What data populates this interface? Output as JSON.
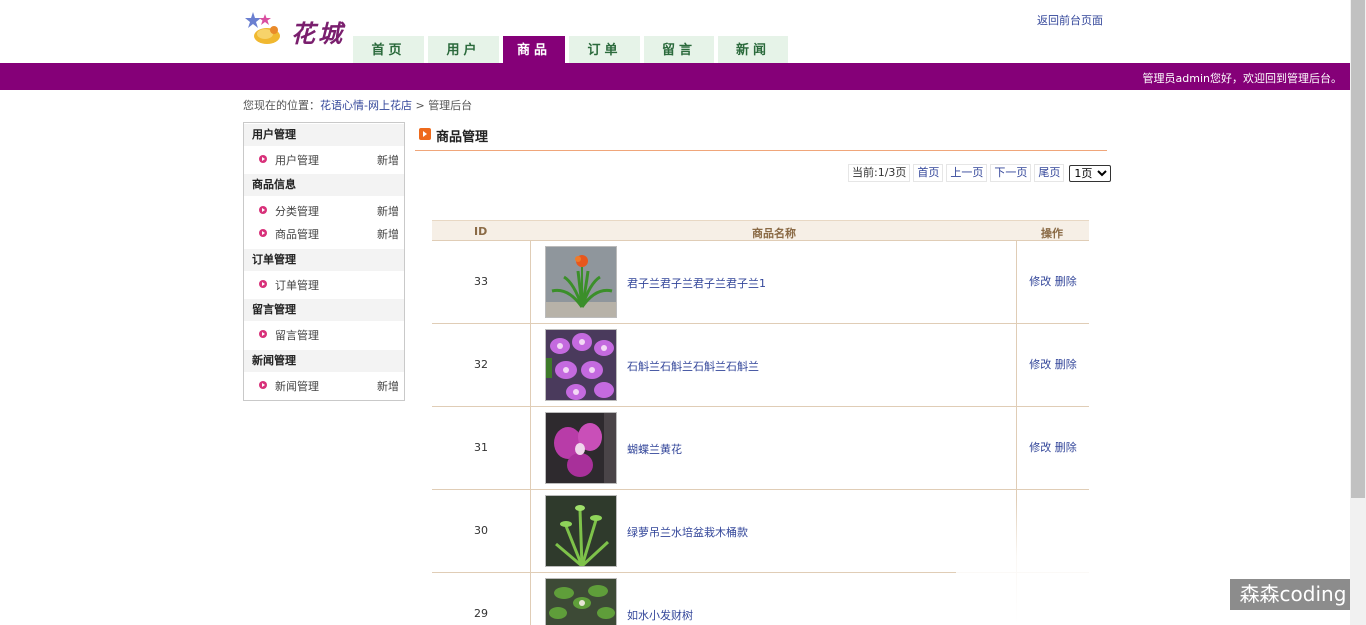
{
  "header": {
    "logo_text": "花城",
    "back_link": "返回前台页面",
    "nav": [
      "首页",
      "用户",
      "商品",
      "订单",
      "留言",
      "新闻"
    ],
    "active_nav": "商品",
    "welcome": "管理员admin您好，欢迎回到管理后台。",
    "accent_color": "#850078"
  },
  "breadcrumb": {
    "prefix": "您现在的位置：",
    "link": "花语心情-网上花店",
    "sep": ">",
    "current": "管理后台"
  },
  "sidebar": {
    "groups": [
      {
        "title": "用户管理",
        "items": [
          {
            "label": "用户管理",
            "add": "新增"
          }
        ]
      },
      {
        "title": "商品信息",
        "items": [
          {
            "label": "分类管理",
            "add": "新增"
          },
          {
            "label": "商品管理",
            "add": "新增"
          }
        ]
      },
      {
        "title": "订单管理",
        "items": [
          {
            "label": "订单管理",
            "add": ""
          }
        ]
      },
      {
        "title": "留言管理",
        "items": [
          {
            "label": "留言管理",
            "add": ""
          }
        ]
      },
      {
        "title": "新闻管理",
        "items": [
          {
            "label": "新闻管理",
            "add": "新增"
          }
        ]
      }
    ]
  },
  "main": {
    "title": "商品管理",
    "pager": {
      "current": "当前:1/3页",
      "first": "首页",
      "prev": "上一页",
      "next": "下一页",
      "last": "尾页",
      "select_value": "1页"
    },
    "table": {
      "headers": {
        "id": "ID",
        "name": "商品名称",
        "op": "操作"
      },
      "rows": [
        {
          "id": "33",
          "name": "君子兰君子兰君子兰君子兰1",
          "edit": "修改",
          "del": "删除"
        },
        {
          "id": "32",
          "name": "石斛兰石斛兰石斛兰石斛兰",
          "edit": "修改",
          "del": "删除"
        },
        {
          "id": "31",
          "name": "蝴蝶兰黄花",
          "edit": "修改",
          "del": "删除"
        },
        {
          "id": "30",
          "name": "绿萝吊兰水培盆栽木桶款",
          "edit": "",
          "del": ""
        },
        {
          "id": "29",
          "name": "如水小发财树",
          "edit": "",
          "del": ""
        }
      ]
    }
  },
  "watermark": "森森coding"
}
